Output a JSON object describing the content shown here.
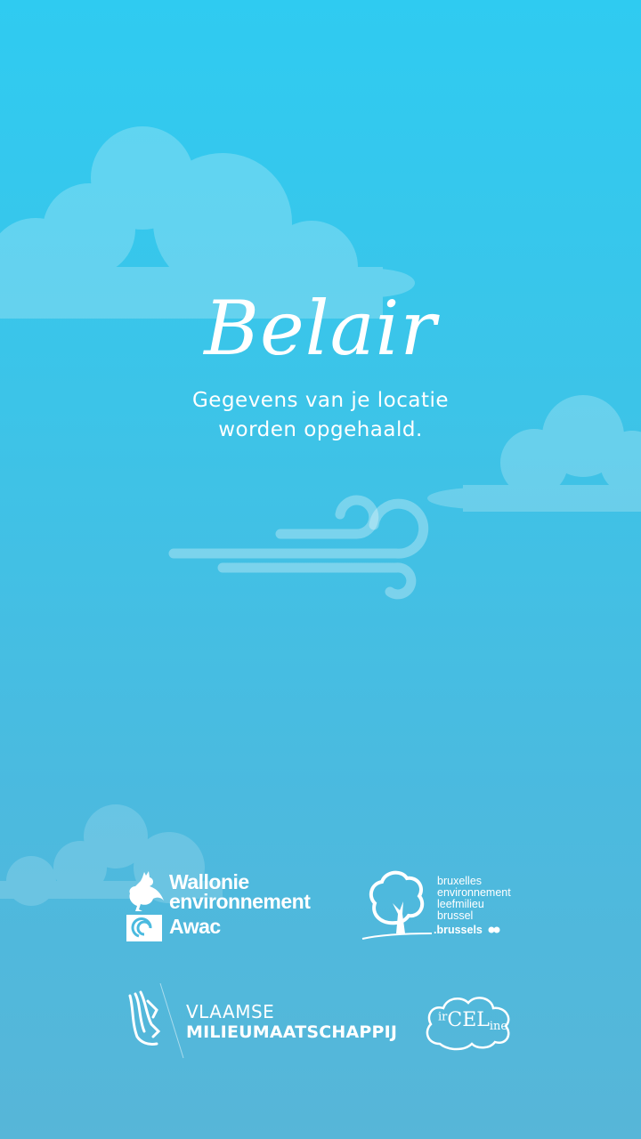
{
  "app": {
    "title": "Belair",
    "status_line_1": "Gegevens van je locatie",
    "status_line_2": "worden opgehaald."
  },
  "partners": {
    "wallonie": {
      "line1": "Wallonie",
      "line2": "environnement",
      "line3": "Awac"
    },
    "bruxelles": {
      "line1": "bruxelles",
      "line2": "environnement",
      "line3": "leefmilieu",
      "line4": "brussel",
      "line5": ".brussels"
    },
    "vmm": {
      "line1": "VLAAMSE",
      "line2": "MILIEUMAATSCHAPPIJ"
    },
    "ircel": {
      "prefix": "ir",
      "main": "CEL",
      "suffix": "ine"
    }
  },
  "colors": {
    "sky_top": "#2fcbf1",
    "sky_bottom": "#57b6d8",
    "text": "#ffffff"
  },
  "icons": [
    "cloud-decoration",
    "wind-icon",
    "rooster-icon",
    "swirl-icon",
    "tree-icon",
    "lion-icon",
    "cloud-outline-icon"
  ]
}
